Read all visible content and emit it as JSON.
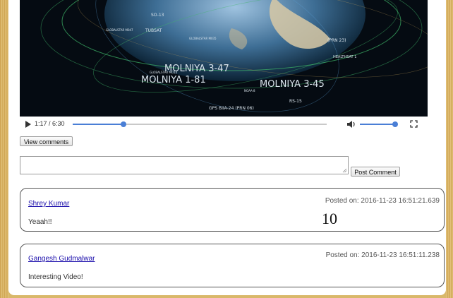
{
  "video": {
    "overlay_labels": [
      "MOLNIYA 3-47",
      "MOLNIYA 1-81",
      "MOLNIYA 3-45",
      "GPS BIIA-24 (PRN 06)",
      "TUBSAT",
      "RS-15",
      "SO-13",
      "(PRN 23)",
      "GLOBALSTAR M035",
      "HEALTHSAT 1",
      "GLOBALSTAR MO14",
      "GLOBALSTAR M047",
      "NOAA-8"
    ],
    "controls": {
      "time": "1:17 / 6:30",
      "progress": 0.2,
      "volume": 1.0,
      "play_icon": "play-icon",
      "volume_icon": "volume-icon",
      "fullscreen_icon": "fullscreen-icon",
      "accent_color": "#4a7fd6"
    }
  },
  "view_comments_label": "View comments",
  "comment_input": {
    "value": ""
  },
  "post_comment_label": "Post Comment",
  "comments": [
    {
      "author": "Shrey Kumar",
      "posted": "Posted on: 2016-11-23 16:51:21.639",
      "text": "Yeaah!!",
      "score": "10"
    },
    {
      "author": "Gangesh Gudmalwar",
      "posted": "Posted on: 2016-11-23 16:51:11.238",
      "text": "Interesting Video!"
    }
  ]
}
